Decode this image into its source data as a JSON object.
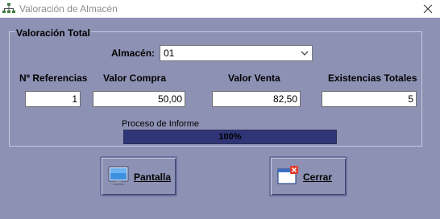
{
  "window": {
    "title": "Valoración de Almacén",
    "icon": "tree-network-icon",
    "close_icon": "close-icon"
  },
  "group": {
    "title": "Valoración Total"
  },
  "almacen": {
    "label": "Almacén:",
    "value": "01"
  },
  "columns": {
    "referencias": "Nº Referencias",
    "valor_compra": "Valor Compra",
    "valor_venta": "Valor Venta",
    "existencias": "Existencias Totales"
  },
  "values": {
    "referencias": "1",
    "valor_compra": "50,00",
    "valor_venta": "82,50",
    "existencias": "5"
  },
  "progress": {
    "label": "Proceso de Informe",
    "percent_text": "100%",
    "fraction": 1.0
  },
  "buttons": {
    "pantalla": "Pantalla",
    "cerrar": "Cerrar"
  },
  "colors": {
    "background": "#8d91b3",
    "progress_fill": "#2f3576"
  }
}
